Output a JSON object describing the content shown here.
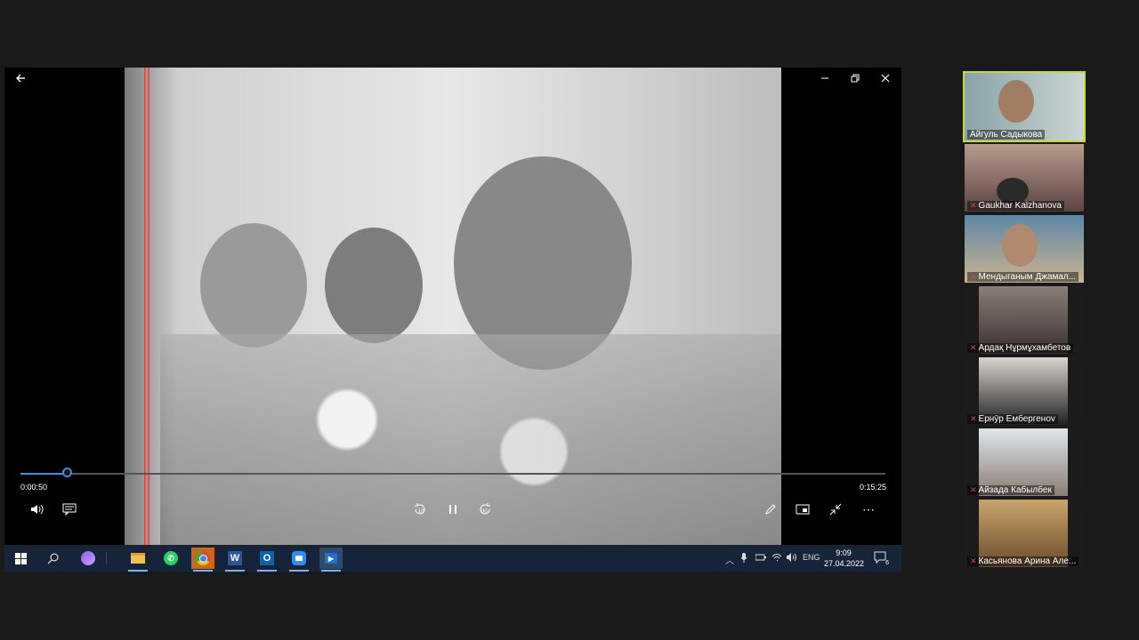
{
  "player": {
    "current_time": "0:00:50",
    "total_time": "0:15:25",
    "progress_fraction": 0.054,
    "colors": {
      "accent": "#3a8ee6"
    }
  },
  "taskbar": {
    "clock_time": "9:09",
    "clock_date": "27.04.2022",
    "language": "ENG",
    "notification_count": "6",
    "apps": [
      {
        "icon": "start-icon"
      },
      {
        "icon": "search-icon"
      },
      {
        "icon": "alice-assistant-icon"
      },
      {
        "icon": "file-explorer-icon"
      },
      {
        "icon": "whatsapp-icon"
      },
      {
        "icon": "chrome-icon"
      },
      {
        "icon": "word-icon",
        "glyph": "W"
      },
      {
        "icon": "outlook-icon",
        "glyph": "O"
      },
      {
        "icon": "zoom-icon"
      },
      {
        "icon": "movies-tv-icon"
      }
    ]
  },
  "participants": [
    {
      "name": "Айгуль Садыкова",
      "muted": false,
      "active_speaker": true
    },
    {
      "name": "Gaukhar Kalzhanova",
      "muted": true
    },
    {
      "name": "Мендыганым Джамал...",
      "muted": true
    },
    {
      "name": "Ардақ Нұрмұхамбетов",
      "muted": true
    },
    {
      "name": "Ернӯр Ембергенov",
      "muted": true
    },
    {
      "name": "Айзада Кабылбек",
      "muted": true
    },
    {
      "name": "Касьянова Арина Але...",
      "muted": true
    }
  ]
}
